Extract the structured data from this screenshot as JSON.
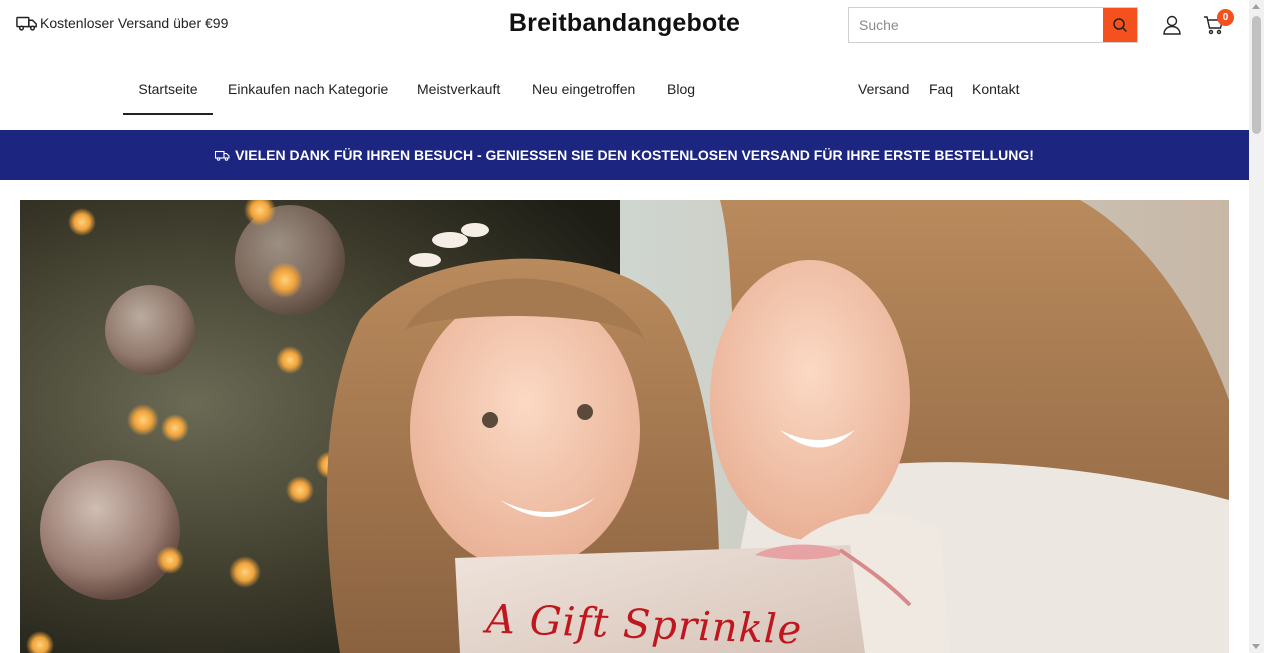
{
  "header": {
    "shipping_note": "Kostenloser Versand über €99",
    "logo": "Breitbandangebote",
    "search": {
      "placeholder": "Suche"
    },
    "cart_count": "0"
  },
  "nav": {
    "left": [
      {
        "label": "Startseite",
        "active": true
      },
      {
        "label": "Einkaufen nach Kategorie"
      },
      {
        "label": "Meistverkauft"
      },
      {
        "label": "Neu eingetroffen"
      },
      {
        "label": "Blog"
      }
    ],
    "right": [
      {
        "label": "Versand"
      },
      {
        "label": "Faq"
      },
      {
        "label": "Kontakt"
      }
    ]
  },
  "announcement": {
    "text": "VIELEN DANK FÜR IHREN BESUCH - GENIESSEN SIE DEN KOSTENLOSEN VERSAND FÜR IHRE ERSTE BESTELLUNG!"
  },
  "hero": {
    "gift_text": "A Gift Sprinkle"
  },
  "colors": {
    "accent": "#f4511e",
    "announcement_bg": "#1c2580",
    "gift_text": "#c0161e"
  },
  "icons": [
    "truck-icon",
    "search-icon",
    "user-icon",
    "cart-icon"
  ]
}
